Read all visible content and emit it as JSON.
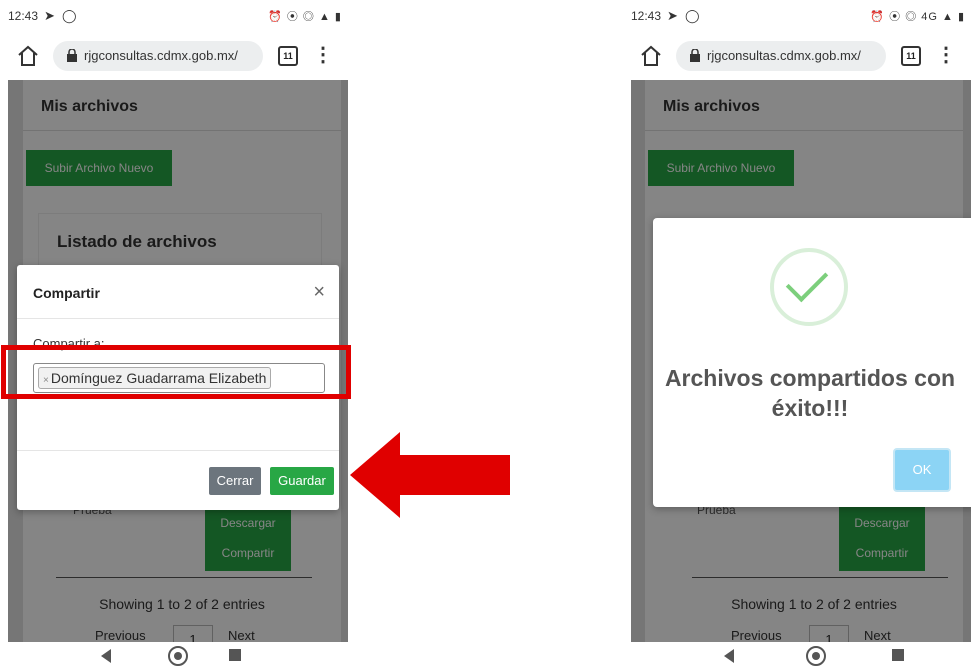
{
  "left": {
    "status": {
      "time": "12:43",
      "icons_right": "⏰ ⦿ ◎ ▲ ▮"
    },
    "browser": {
      "url": "rjgconsultas.cdmx.gob.mx/",
      "tab_count": "11"
    },
    "page": {
      "title": "Mis archivos",
      "upload_label": "Subir Archivo Nuevo",
      "list_title": "Listado de archivos",
      "row_name": "Prueba",
      "download_label": "Descargar",
      "share_label": "Compartir",
      "showing": "Showing 1 to 2 of 2 entries",
      "prev": "Previous",
      "page_num": "1",
      "next": "Next"
    },
    "modal": {
      "title": "Compartir",
      "close": "×",
      "field_label": "Compartir a:",
      "tag_remove": "×",
      "tag_value": "Domínguez Guadarrama Elizabeth",
      "cancel_label": "Cerrar",
      "save_label": "Guardar"
    }
  },
  "right": {
    "status": {
      "time": "12:43",
      "icons_right": "⏰ ⦿ ◎ 4G ▲ ▮"
    },
    "browser": {
      "url": "rjgconsultas.cdmx.gob.mx/",
      "tab_count": "11"
    },
    "page": {
      "title": "Mis archivos",
      "upload_label": "Subir Archivo Nuevo",
      "row_name": "Prueba",
      "download_label": "Descargar",
      "share_label": "Compartir",
      "showing": "Showing 1 to 2 of 2 entries",
      "prev": "Previous",
      "page_num": "1",
      "next": "Next"
    },
    "alert": {
      "title": "Archivos compartidos con éxito!!!",
      "ok_label": "OK"
    }
  },
  "colors": {
    "accent_green": "#28a745",
    "highlight_red": "#e00000",
    "ok_blue": "#8cd4f5"
  }
}
